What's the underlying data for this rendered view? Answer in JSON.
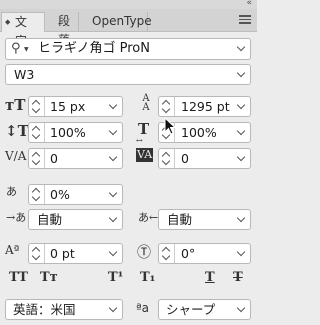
{
  "panel": {
    "tabs": [
      {
        "label": "文字"
      },
      {
        "label": "段落"
      },
      {
        "label": "OpenType"
      }
    ]
  },
  "font_family": {
    "value": "ヒラギノ角ゴ ProN"
  },
  "font_style": {
    "value": "W3"
  },
  "font_size": {
    "value": "15 px"
  },
  "leading": {
    "value": "1295 pt"
  },
  "vertical_scale": {
    "value": "100%"
  },
  "horizontal_scale": {
    "value": "100%"
  },
  "kerning": {
    "value": "0"
  },
  "tracking": {
    "value": "0"
  },
  "tsume": {
    "value": "0%"
  },
  "aki_left": {
    "value": "自動"
  },
  "aki_right": {
    "value": "自動"
  },
  "baseline_shift": {
    "value": "0 pt"
  },
  "rotation": {
    "value": "0°"
  },
  "language": {
    "value": "英語：米国"
  },
  "antialias": {
    "value": "シャープ"
  },
  "text_style_buttons": [
    "TT",
    "Tт",
    "T¹",
    "T₁",
    "T",
    "T"
  ]
}
